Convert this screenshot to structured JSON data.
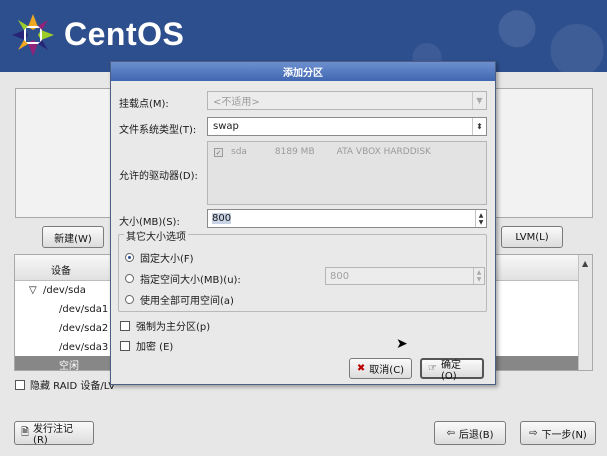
{
  "brand": {
    "name": "CentOS"
  },
  "main": {
    "new_button": "新建(W)",
    "lvm_button": "LVM(L)",
    "table": {
      "header_device": "设备",
      "rows": [
        {
          "indent": 0,
          "label": "/dev/sda",
          "toggle": "▽"
        },
        {
          "indent": 1,
          "label": "/dev/sda1"
        },
        {
          "indent": 1,
          "label": "/dev/sda2"
        },
        {
          "indent": 1,
          "label": "/dev/sda3"
        },
        {
          "indent": 1,
          "label": "空闲"
        }
      ]
    },
    "hide_raid_label": "隐藏 RAID 设备/LV",
    "release_notes_button": "发行注记(R)",
    "back_button": "后退(B)",
    "next_button": "下一步(N)"
  },
  "dialog": {
    "title": "添加分区",
    "mount_point_label": "挂载点(M):",
    "mount_point_value": "<不适用>",
    "fs_type_label": "文件系统类型(T):",
    "fs_type_value": "swap",
    "allowed_drives_label": "允许的驱动器(D):",
    "drive": {
      "checked": true,
      "name": "sda",
      "size": "8189 MB",
      "model": "ATA VBOX HARDDISK"
    },
    "size_label": "大小(MB)(S):",
    "size_value": "800",
    "other_size_title": "其它大小选项",
    "fixed_size_label": "固定大小(F)",
    "max_size_label": "指定空间大小(MB)(u):",
    "max_size_value": "800",
    "fill_all_label": "使用全部可用空间(a)",
    "selected_option": "fixed",
    "force_primary_label": "强制为主分区(p)",
    "encrypt_label": "加密 (E)",
    "cancel_button": "取消(C)",
    "ok_button": "确定(O)"
  },
  "colors": {
    "banner": "#2e4f8e",
    "dialog_title": "#3f67b1",
    "selected_row": "#878787"
  }
}
